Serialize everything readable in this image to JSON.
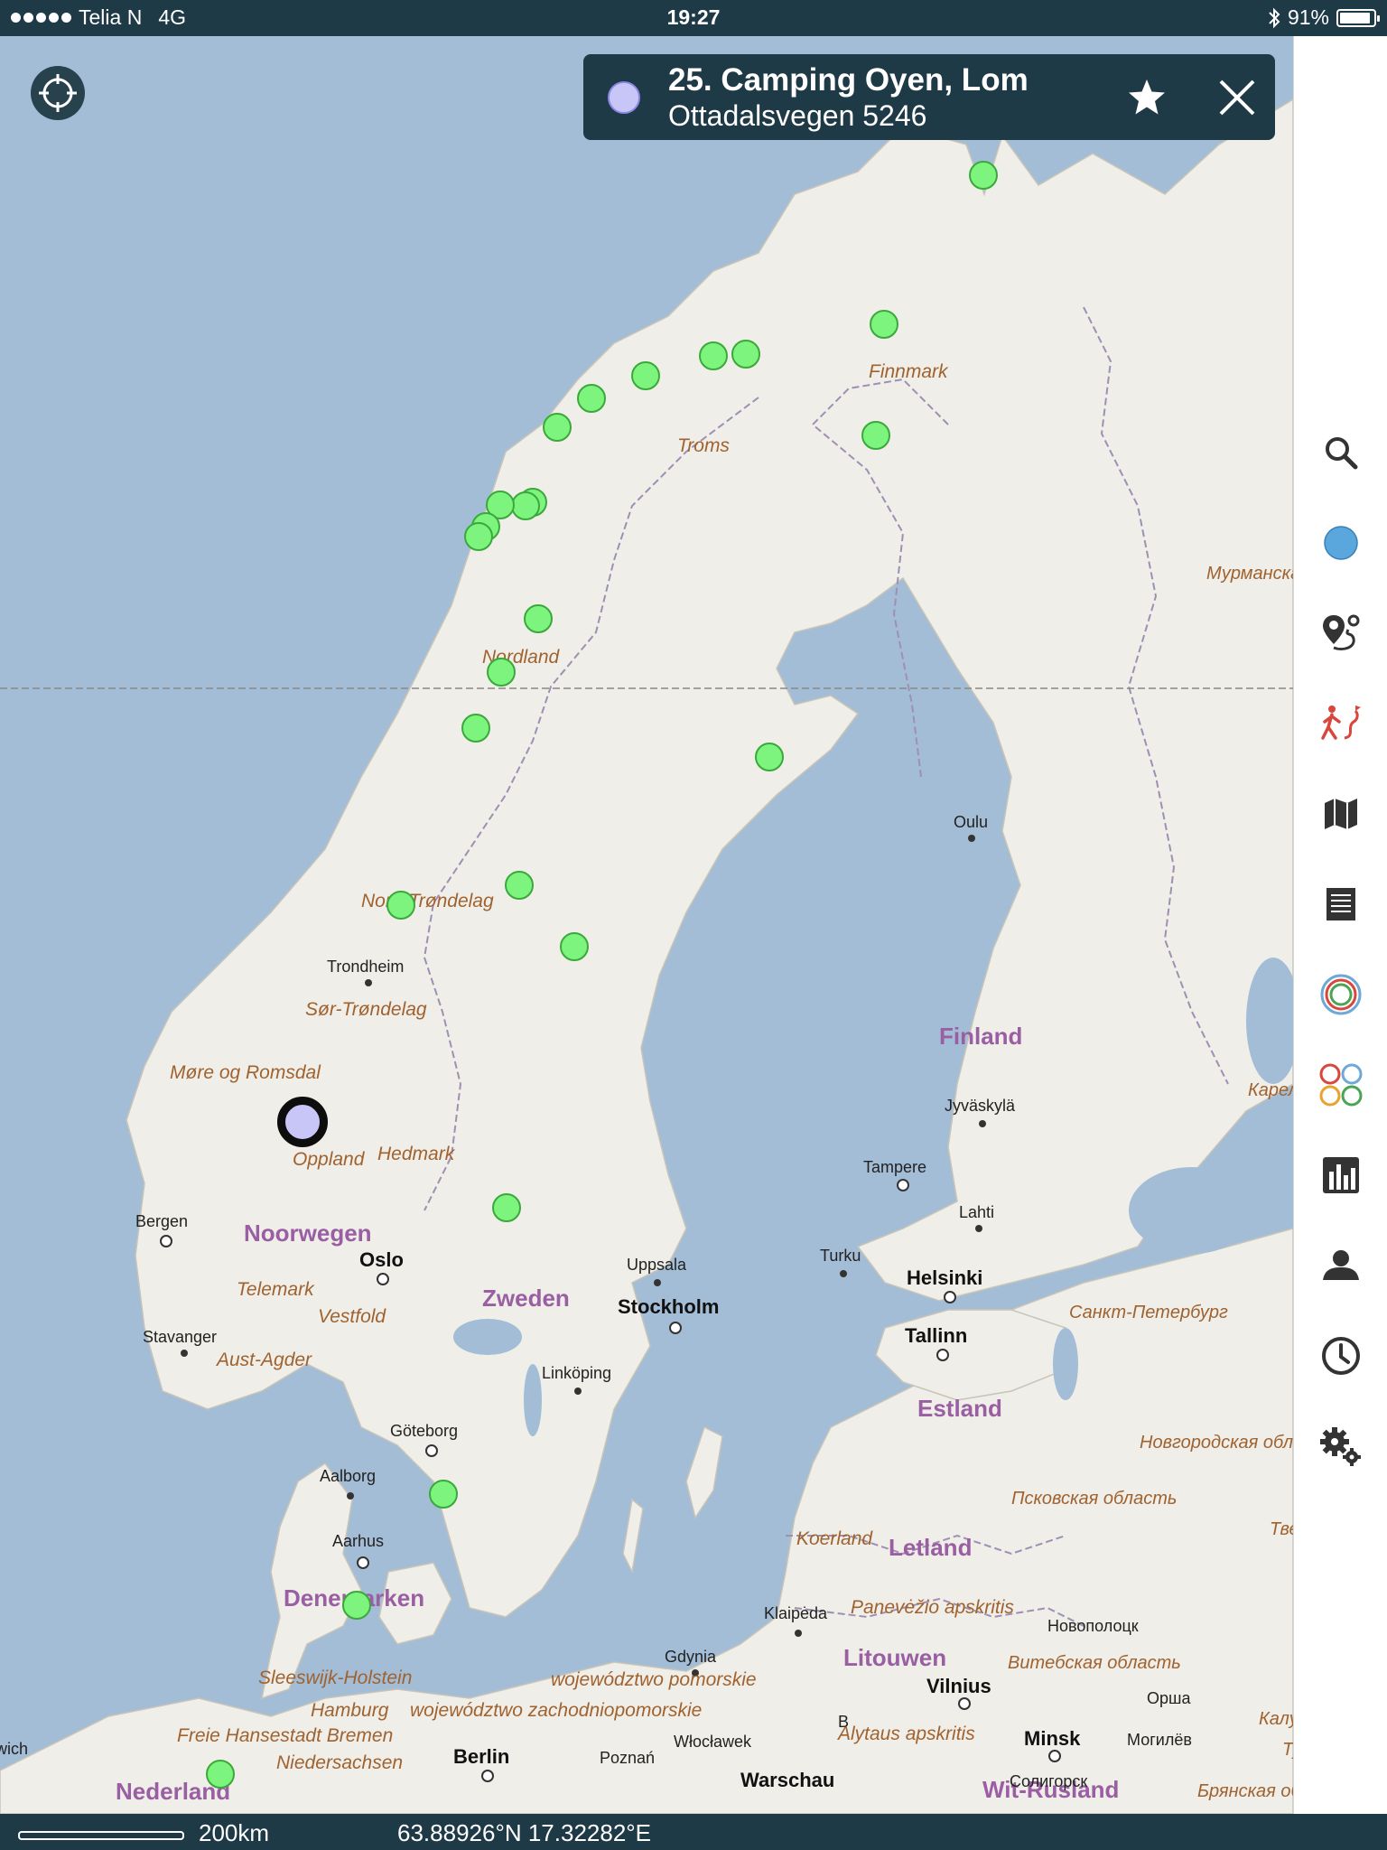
{
  "status_bar": {
    "carrier": "Telia N",
    "network": "4G",
    "time": "19:27",
    "battery": "91%",
    "battery_level": 0.91
  },
  "info_card": {
    "title": "25. Camping Oyen, Lom",
    "address": "Ottadalsvegen 5246",
    "favorite_icon": "star-icon",
    "close_icon": "close-icon"
  },
  "toolbar": {
    "items": [
      {
        "name": "search-icon"
      },
      {
        "name": "location-dot-icon"
      },
      {
        "name": "route-pin-icon"
      },
      {
        "name": "hiking-icon"
      },
      {
        "name": "map-icon"
      },
      {
        "name": "list-icon"
      },
      {
        "name": "target-rings-icon"
      },
      {
        "name": "color-circles-icon"
      },
      {
        "name": "chart-icon"
      },
      {
        "name": "account-icon"
      },
      {
        "name": "history-icon"
      },
      {
        "name": "settings-icon"
      }
    ]
  },
  "bottom_bar": {
    "scale": "200km",
    "coordinates": "63.88926°N 17.32282°E"
  },
  "map": {
    "labels": {
      "finnmark": "Finnmark",
      "troms": "Troms",
      "nordland": "Nordland",
      "nord_trondelag": "Nord-Trøndelag",
      "trondheim": "Trondheim",
      "sor_trondelag": "Sør-Trøndelag",
      "more_romsdal": "Møre og Romsdal",
      "oppland": "Oppland",
      "hedmark": "Hedmark",
      "bergen": "Bergen",
      "noorwegen": "Noorwegen",
      "oslo": "Oslo",
      "telemark": "Telemark",
      "vestfold": "Vestfold",
      "stavanger": "Stavanger",
      "aust_agder": "Aust-Agder",
      "zweden": "Zweden",
      "uppsala": "Uppsala",
      "stockholm": "Stockholm",
      "linkoping": "Linköping",
      "goteborg": "Göteborg",
      "aalborg": "Aalborg",
      "aarhus": "Aarhus",
      "denemarken": "Denemarken",
      "sleeswijk": "Sleeswijk-Holstein",
      "hamburg": "Hamburg",
      "bremen": "Freie Hansestadt Bremen",
      "niedersachsen": "Niedersachsen",
      "nederland": "Nederland",
      "norwich": "Norwich",
      "berlin": "Berlin",
      "poznan": "Poznań",
      "wloclawek": "Włocławek",
      "warschau": "Warschau",
      "gdynia": "Gdynia",
      "pomorskie": "województwo pomorskie",
      "zachodniopomorskie": "województwo zachodniopomorskie",
      "b": "B",
      "oulu": "Oulu",
      "finland": "Finland",
      "jyvaskyla": "Jyväskylä",
      "tampere": "Tampere",
      "lahti": "Lahti",
      "turku": "Turku",
      "helsinki": "Helsinki",
      "tallinn": "Tallinn",
      "estland": "Estland",
      "koerland": "Koerland",
      "letland": "Letland",
      "klaipeda": "Klaipėda",
      "panevezio": "Panevėžio apskritis",
      "litouwen": "Litouwen",
      "vilnius": "Vilnius",
      "alytaus": "Alytaus apskritis",
      "minsk": "Minsk",
      "wit_rusland": "Wit-Rusland",
      "murmansk": "Мурманская область",
      "karelia": "Карелия",
      "spb": "Санкт-Петербург",
      "novgorod": "Новгородская область",
      "pskov": "Псковская область",
      "tver": "Тверская область",
      "novopolotsk": "Новополоцк",
      "vitebsk": "Витебская область",
      "orsha": "Орша",
      "mogilev": "Могилёв",
      "kaluga": "Калужская",
      "tula": "Тула",
      "soligorsk": "Солигорск",
      "bryansk": "Брянская область"
    }
  }
}
